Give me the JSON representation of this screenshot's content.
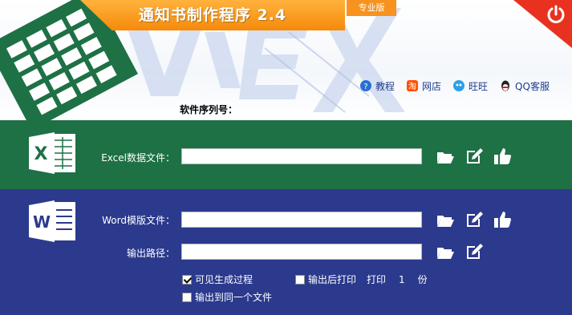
{
  "app": {
    "title": "通知书制作程序 2.4",
    "edition": "专业版"
  },
  "nav": {
    "tutorial": "教程",
    "shop": "网店",
    "wangwang": "旺旺",
    "qq_service": "QQ客服"
  },
  "serial": {
    "label": "软件序列号："
  },
  "excel": {
    "label": "Excel数据文件：",
    "value": ""
  },
  "word": {
    "label": "Word模版文件：",
    "value": ""
  },
  "output": {
    "label": "输出路径：",
    "value": ""
  },
  "options": {
    "visible_process": {
      "label": "可见生成过程",
      "checked": true
    },
    "print_after_output": {
      "label": "输出后打印",
      "checked": false
    },
    "print_label": "打印",
    "print_count": "1",
    "copies_unit": "份",
    "single_file": {
      "label": "输出到同一个文件",
      "checked": false
    }
  },
  "colors": {
    "excel_band": "#1e7145",
    "word_band": "#2b3a8c",
    "title_orange": "#f58a0b",
    "power_red": "#e8321f"
  },
  "icons": {
    "open": "folder-open-icon",
    "edit": "edit-icon",
    "like": "thumbs-up-icon"
  }
}
